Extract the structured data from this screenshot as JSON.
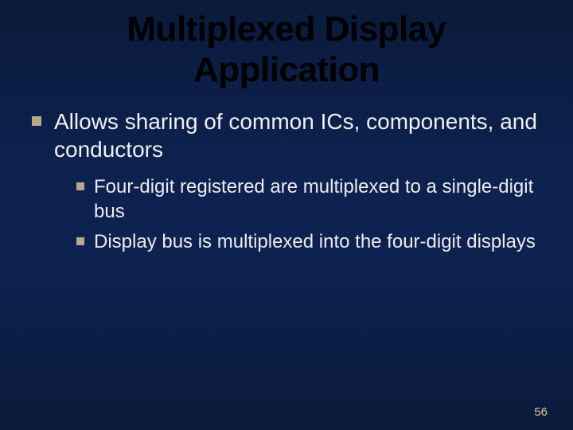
{
  "slide": {
    "title": "Multiplexed Display Application",
    "bullets": [
      {
        "text": "Allows sharing of common ICs, components, and conductors",
        "sub": [
          {
            "text": "Four-digit registered are multiplexed to a single-digit bus"
          },
          {
            "text": "Display bus is multiplexed into the four-digit displays"
          }
        ]
      }
    ],
    "page_number": "56"
  },
  "colors": {
    "bullet_square": "#b8a98a",
    "title_color": "#000000",
    "bg_top": "#0a1a3a",
    "bg_mid": "#0d2250"
  }
}
